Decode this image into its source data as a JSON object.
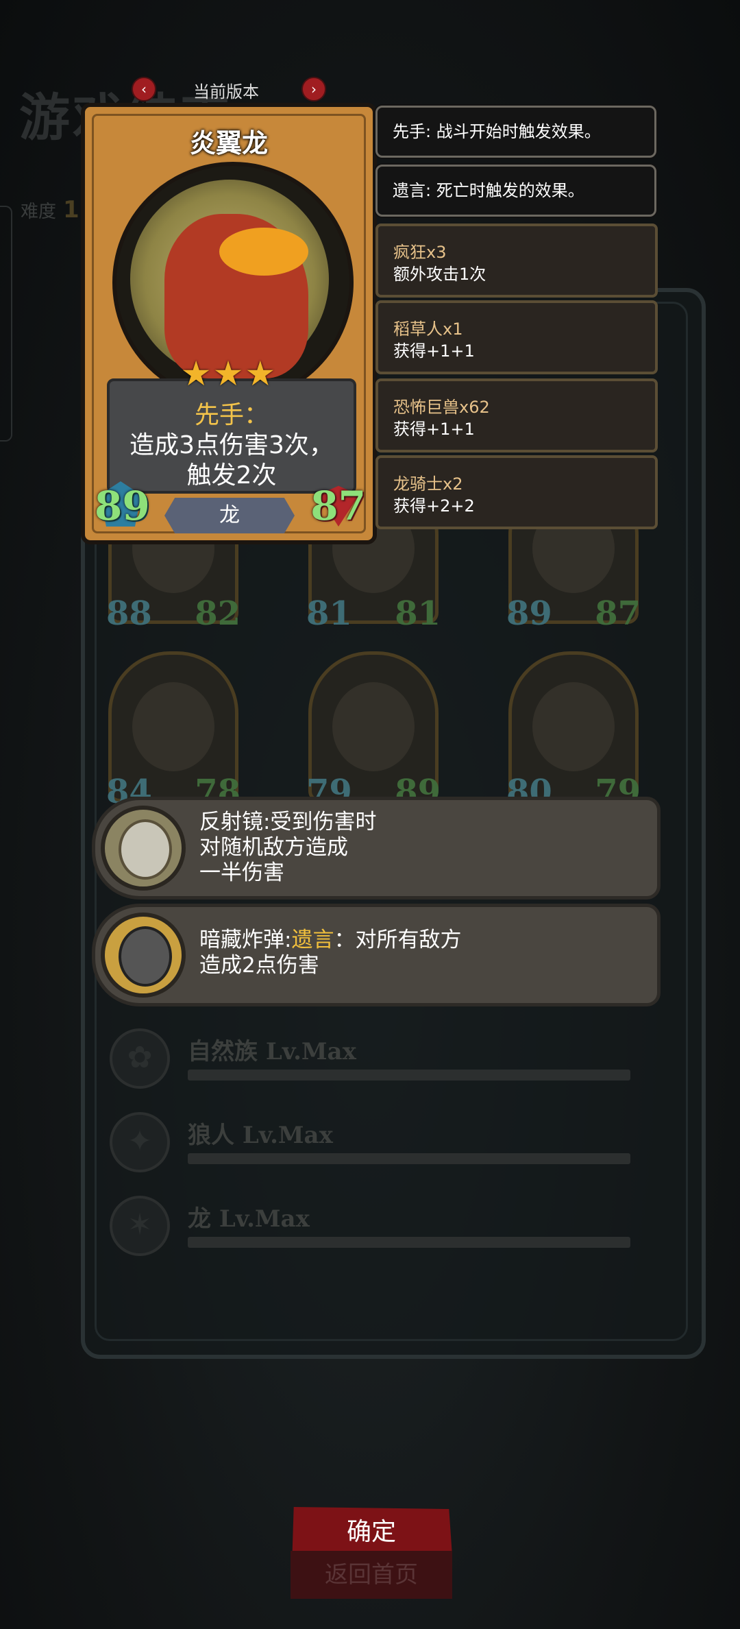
{
  "background": {
    "title": "游戏结束",
    "difficulty_label": "难度",
    "difficulty_value": "1"
  },
  "mini_cards": [
    {
      "attack": "88",
      "health": "82"
    },
    {
      "attack": "81",
      "health": "81"
    },
    {
      "attack": "89",
      "health": "87"
    },
    {
      "attack": "84",
      "health": "78"
    },
    {
      "attack": "79",
      "health": "89"
    },
    {
      "attack": "80",
      "health": "79"
    }
  ],
  "tribes": [
    {
      "label": "自然族 Lv.Max",
      "icon": "nature-emblem-icon"
    },
    {
      "label": "狼人 Lv.Max",
      "icon": "werewolf-emblem-icon"
    },
    {
      "label": "龙 Lv.Max",
      "icon": "dragon-emblem-icon"
    }
  ],
  "buttons": {
    "confirm": "确定",
    "home": "返回首页"
  },
  "version": {
    "label": "当前版本"
  },
  "card": {
    "name": "炎翼龙",
    "stars": "★★★",
    "ability_keyword": "先手：",
    "ability_line2": "造成3点伤害3次，",
    "ability_line3": "触发2次",
    "attack": "89",
    "health": "87",
    "tribe": "龙"
  },
  "keywords": [
    {
      "text": "先手: 战斗开始时触发效果。"
    },
    {
      "text": "遗言: 死亡时触发的效果。"
    }
  ],
  "synergies": [
    {
      "name": "疯狂x3",
      "desc": "额外攻击1次"
    },
    {
      "name": "稻草人x1",
      "desc": "获得+1+1"
    },
    {
      "name": "恐怖巨兽x62",
      "desc": "获得+1+1"
    },
    {
      "name": "龙骑士x2",
      "desc": "获得+2+2"
    }
  ],
  "relics": [
    {
      "line1": "反射镜:受到伤害时",
      "line2": "对随机敌方造成",
      "line3": "一半伤害",
      "icon": "mirror-icon"
    },
    {
      "line1_a": "暗藏炸弹:",
      "line1_kw": "遗言",
      "line1_b": "：对所有敌方",
      "line2": "造成2点伤害",
      "icon": "bomb-icon"
    }
  ],
  "colors": {
    "card_wood": "#c7883a",
    "confirm_red": "#7d1216",
    "keyword_yellow": "#f2c03c",
    "stat_green": "#8ee07a"
  }
}
